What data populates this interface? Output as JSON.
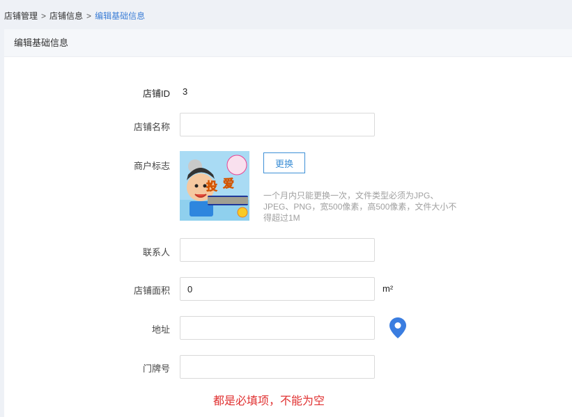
{
  "breadcrumb": {
    "items": [
      "店铺管理",
      "店铺信息",
      "编辑基础信息"
    ],
    "separator": ">"
  },
  "panel": {
    "title": "编辑基础信息"
  },
  "form": {
    "shop_id": {
      "label": "店铺ID",
      "value": "3"
    },
    "shop_name": {
      "label": "店铺名称",
      "value": "",
      "placeholder": ""
    },
    "logo": {
      "label": "商户标志",
      "change_label": "更换",
      "hint": "一个月内只能更换一次，文件类型必须为JPG、JPEG、PNG，宽500像素，高500像素，文件大小不得超过1M"
    },
    "contact": {
      "label": "联系人",
      "value": ""
    },
    "area": {
      "label": "店铺面积",
      "value": "0",
      "unit": "m²"
    },
    "address": {
      "label": "地址",
      "value": ""
    },
    "door_number": {
      "label": "门牌号",
      "value": ""
    }
  },
  "required_note": "都是必填项，不能为空",
  "colors": {
    "accent": "#3d8fd6",
    "breadcrumb_current": "#3d7fd6",
    "error": "#e03030",
    "location_pin": "#3a7de0"
  },
  "icons": {
    "location": "location-pin-icon"
  }
}
